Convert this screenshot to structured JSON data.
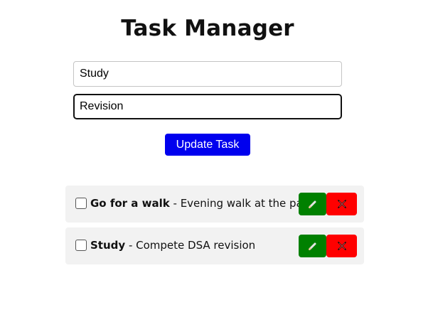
{
  "app": {
    "title": "Task Manager"
  },
  "form": {
    "title_value": "Study",
    "description_value": "Revision",
    "submit_label": "Update Task"
  },
  "tasks": [
    {
      "title": "Go for a walk",
      "separator": " - ",
      "description": "Evening walk at the park",
      "completed": false,
      "edit_icon": "pencil-icon",
      "delete_icon": "cross-icon"
    },
    {
      "title": "Study",
      "separator": " - ",
      "description": "Compete DSA revision",
      "completed": false,
      "edit_icon": "pencil-icon",
      "delete_icon": "cross-icon"
    }
  ],
  "colors": {
    "primary": "#0000ee",
    "edit": "#008000",
    "delete": "#ff0000",
    "row_bg": "#f2f2f2"
  }
}
